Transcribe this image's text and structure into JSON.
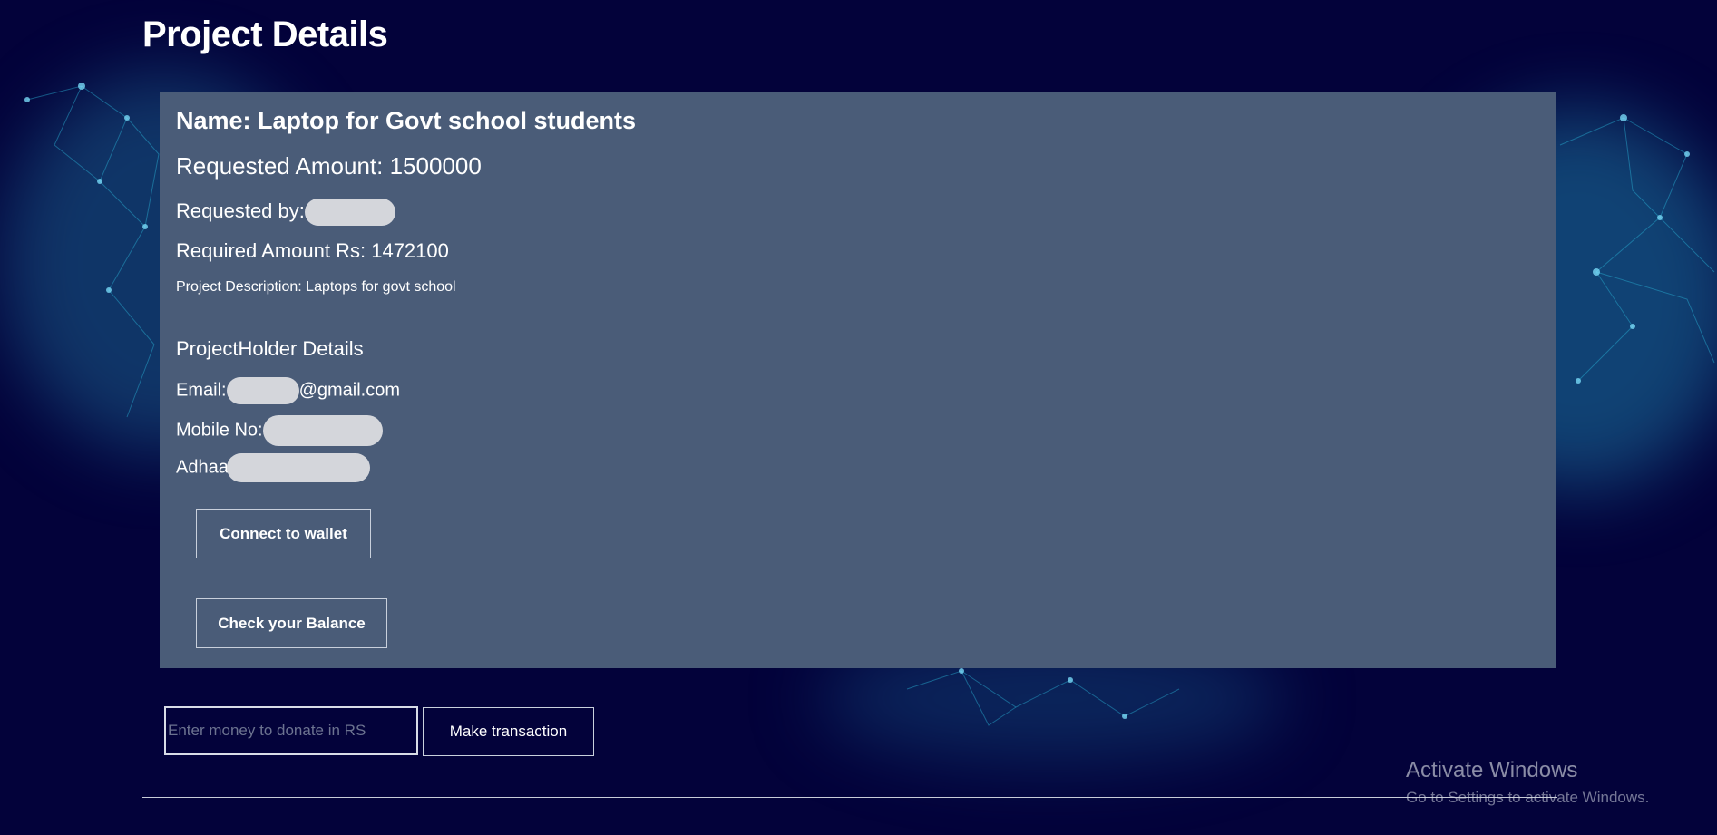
{
  "page": {
    "title": "Project Details"
  },
  "project": {
    "name_line": "Name: Laptop for Govt school students",
    "requested_amount_line": "Requested Amount: 1500000",
    "requested_by_label": "Requested by:",
    "required_amount_line": "Required Amount Rs: 1472100",
    "description_line": "Project Description: Laptops for govt school"
  },
  "holder": {
    "heading": "ProjectHolder Details",
    "email_label": "Email:",
    "email_suffix": "@gmail.com",
    "mobile_label": "Mobile No:",
    "adhaar_label": "Adhaar:"
  },
  "actions": {
    "connect_wallet_label": "Connect to wallet",
    "check_balance_label": "Check your Balance",
    "donate_placeholder": "Enter money to donate in RS",
    "make_transaction_label": "Make transaction"
  },
  "watermark": {
    "title": "Activate Windows",
    "subtitle": "Go to Settings to activate Windows."
  },
  "colors": {
    "page_background": "#03023a",
    "card_background": "#4a5c78",
    "redaction": "#d4d6db",
    "accent_network": "#2ab4d8"
  }
}
